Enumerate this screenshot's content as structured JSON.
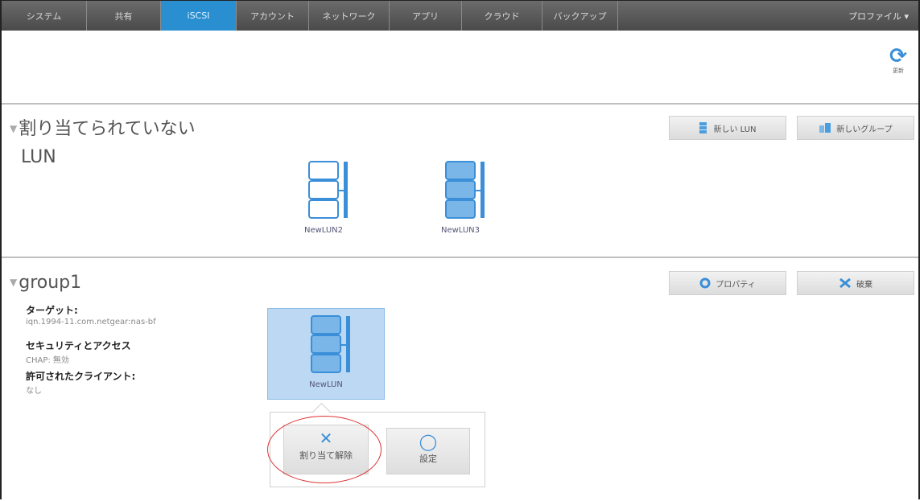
{
  "nav": {
    "tabs": [
      {
        "label": "システム"
      },
      {
        "label": "共有"
      },
      {
        "label": "iSCSI"
      },
      {
        "label": "アカウント"
      },
      {
        "label": "ネットワーク"
      },
      {
        "label": "アプリ"
      },
      {
        "label": "クラウド"
      },
      {
        "label": "バックアップ"
      }
    ],
    "profile_label": "プロファイル ▾"
  },
  "refresh": {
    "label": "更新"
  },
  "unassigned": {
    "title_line1": "割り当てられていない",
    "title_line2": "LUN",
    "new_lun_label": "新しい LUN",
    "new_group_label": "新しいグループ",
    "luns": [
      {
        "name": "NewLUN2"
      },
      {
        "name": "NewLUN3"
      }
    ]
  },
  "group": {
    "title": "group1",
    "properties_label": "プロパティ",
    "delete_label": "破棄",
    "target_label": "ターゲット:",
    "target_value": "iqn.1994-11.com.netgear:nas-bf",
    "security_label": "セキュリティとアクセス",
    "security_value": "CHAP: 無効",
    "clients_label": "許可されたクライアント:",
    "clients_value": "なし",
    "lun": {
      "name": "NewLUN"
    },
    "popup": {
      "unassign_label": "割り当て解除",
      "settings_label": "設定"
    }
  },
  "colors": {
    "accent": "#2a8fd0",
    "icon_blue": "#3a8fd8",
    "highlight": "#d33333"
  }
}
